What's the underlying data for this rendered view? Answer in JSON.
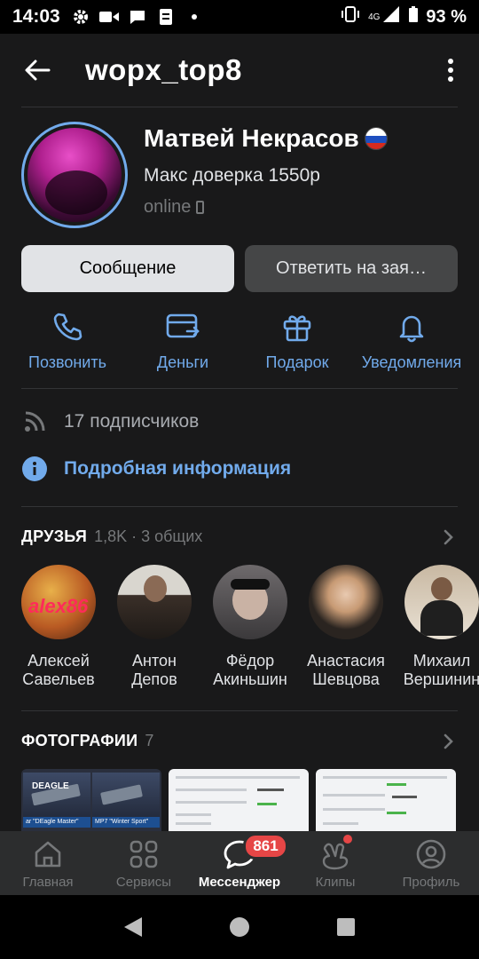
{
  "status_bar": {
    "time": "14:03",
    "network": "4G",
    "battery": "93 %"
  },
  "header": {
    "title": "wopx_top8"
  },
  "profile": {
    "name": "Матвей Некрасов",
    "status": "Макс доверка 1550р",
    "online": "online"
  },
  "buttons": {
    "message": "Сообщение",
    "reply_request": "Ответить на зая…"
  },
  "actions": [
    {
      "label": "Позвонить",
      "icon": "phone-icon"
    },
    {
      "label": "Деньги",
      "icon": "money-icon"
    },
    {
      "label": "Подарок",
      "icon": "gift-icon"
    },
    {
      "label": "Уведомления",
      "icon": "bell-icon"
    }
  ],
  "info": {
    "followers": "17 подписчиков",
    "details": "Подробная информация"
  },
  "friends_section": {
    "title": "ДРУЗЬЯ",
    "count": "1,8K · 3 общих",
    "items": [
      {
        "first": "Алексей",
        "last": "Савельев",
        "avatar_text": "alex86"
      },
      {
        "first": "Антон",
        "last": "Депов"
      },
      {
        "first": "Фёдор",
        "last": "Акиньшин"
      },
      {
        "first": "Анастасия",
        "last": "Шевцова"
      },
      {
        "first": "Михаил",
        "last": "Вершинин"
      }
    ]
  },
  "photos_section": {
    "title": "ФОТОГРАФИИ",
    "count": "7",
    "photo1": {
      "cap1": "ar \"DEagle Master\"",
      "cap2": "MP7 \"Winter Sport\"",
      "logo": "DEAGLE"
    }
  },
  "bottom_nav": {
    "tabs": [
      {
        "label": "Главная"
      },
      {
        "label": "Сервисы"
      },
      {
        "label": "Мессенджер",
        "badge": "861"
      },
      {
        "label": "Клипы"
      },
      {
        "label": "Профиль"
      }
    ]
  },
  "colors": {
    "background": "#19191a",
    "accent": "#71aaeb",
    "badge": "#e64646",
    "nav_bg": "#2c2d2e"
  }
}
